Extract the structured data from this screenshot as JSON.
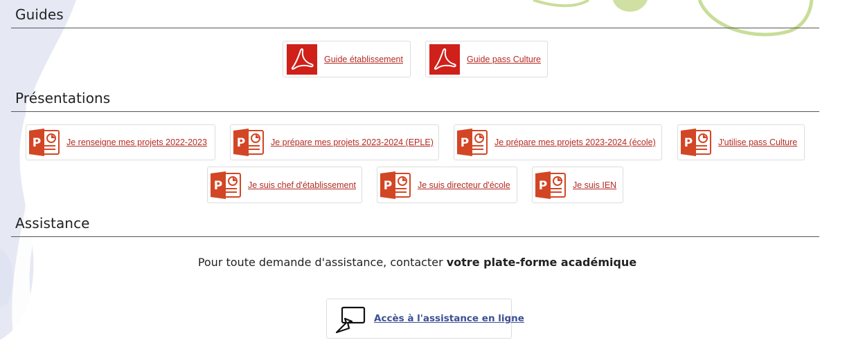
{
  "sections": {
    "guides": {
      "title": "Guides"
    },
    "presentations": {
      "title": "Présentations"
    },
    "assistance": {
      "title": "Assistance"
    }
  },
  "guides": [
    {
      "label": "Guide établissement",
      "icon": "pdf-icon"
    },
    {
      "label": "Guide pass Culture",
      "icon": "pdf-icon"
    }
  ],
  "presentations": [
    {
      "label": "Je renseigne mes projets 2022-2023",
      "icon": "powerpoint-icon"
    },
    {
      "label": "Je prépare mes projets 2023-2024 (EPLE)",
      "icon": "powerpoint-icon"
    },
    {
      "label": "Je prépare mes projets 2023-2024 (école)",
      "icon": "powerpoint-icon"
    },
    {
      "label": "J'utilise pass Culture",
      "icon": "powerpoint-icon"
    },
    {
      "label": "Je suis chef d'établissement",
      "icon": "powerpoint-icon"
    },
    {
      "label": "Je suis directeur d'école",
      "icon": "powerpoint-icon"
    },
    {
      "label": "Je suis IEN",
      "icon": "powerpoint-icon"
    }
  ],
  "assistance": {
    "text_prefix": "Pour toute demande d'assistance, contacter ",
    "text_bold": "votre plate-forme académique",
    "button_label": "Accès à l'assistance en ligne",
    "button_icon": "screen-cursor-icon"
  },
  "colors": {
    "link": "#b52a22",
    "pdf_red": "#d0201a",
    "powerpoint_orange": "#d24625",
    "assist_link": "#3b4f94",
    "decor_blue": "#e3e7f3",
    "decor_green": "#c9dd9a"
  }
}
